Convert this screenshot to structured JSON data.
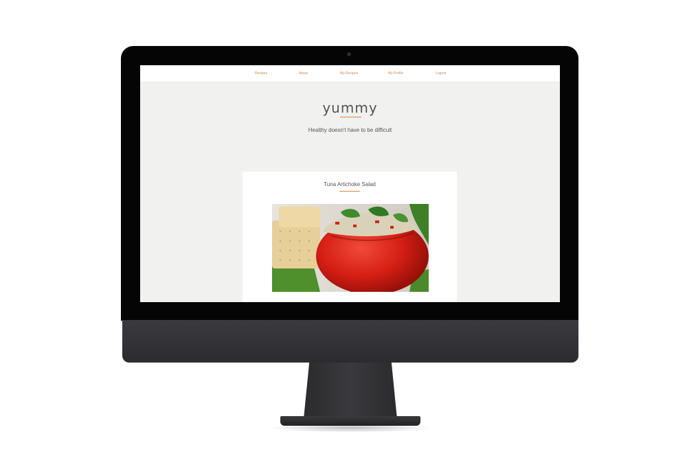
{
  "nav": {
    "items": [
      {
        "label": "Recipes"
      },
      {
        "label": "About"
      },
      {
        "label": "My Recipes"
      },
      {
        "label": "My Profile"
      },
      {
        "label": "Logout"
      }
    ]
  },
  "header": {
    "logo": "yummy",
    "tagline": "Healthy doesn't have to be difficult"
  },
  "recipe_card": {
    "title": "Tuna Artichoke Salad",
    "image_icon": "stuffed-tomato-photo"
  },
  "colors": {
    "accent": "#d9884f",
    "text": "#555555",
    "page_background": "#f1f1f0"
  }
}
